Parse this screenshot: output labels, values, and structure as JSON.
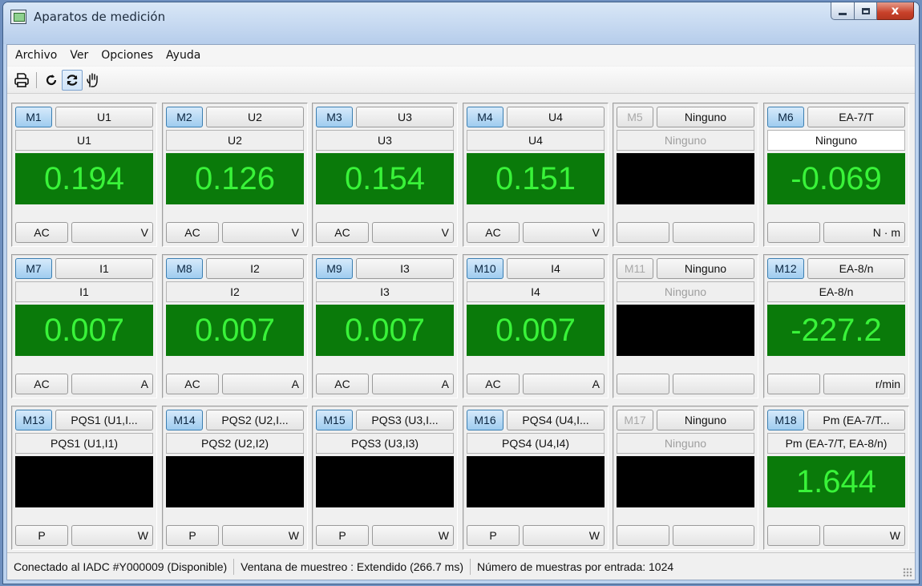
{
  "window": {
    "title": "Aparatos de medición",
    "close_glyph": "x"
  },
  "menu": [
    "Archivo",
    "Ver",
    "Opciones",
    "Ayuda"
  ],
  "toolbar": {
    "icons": [
      "printer-icon",
      "refresh-once-icon",
      "refresh-continuous-icon",
      "hand-icon"
    ],
    "active": "refresh-continuous-icon"
  },
  "colors": {
    "display_live": "#0a7a0a",
    "display_text": "#39f339",
    "display_off": "#000000",
    "button_active": "#9fccef"
  },
  "meters": [
    {
      "id": "M1",
      "active": true,
      "channel": "U1",
      "label": "U1",
      "value": "0.194",
      "mode": "AC",
      "unit": "V"
    },
    {
      "id": "M2",
      "active": true,
      "channel": "U2",
      "label": "U2",
      "value": "0.126",
      "mode": "AC",
      "unit": "V"
    },
    {
      "id": "M3",
      "active": true,
      "channel": "U3",
      "label": "U3",
      "value": "0.154",
      "mode": "AC",
      "unit": "V"
    },
    {
      "id": "M4",
      "active": true,
      "channel": "U4",
      "label": "U4",
      "value": "0.151",
      "mode": "AC",
      "unit": "V"
    },
    {
      "id": "M5",
      "active": false,
      "channel": "Ninguno",
      "label": "Ninguno",
      "value": "",
      "mode": "",
      "unit": ""
    },
    {
      "id": "M6",
      "active": true,
      "channel": "EA-7/T",
      "label": "Ninguno",
      "value": "-0.069",
      "mode": "",
      "unit": "N · m"
    },
    {
      "id": "M7",
      "active": true,
      "channel": "I1",
      "label": "I1",
      "value": "0.007",
      "mode": "AC",
      "unit": "A"
    },
    {
      "id": "M8",
      "active": true,
      "channel": "I2",
      "label": "I2",
      "value": "0.007",
      "mode": "AC",
      "unit": "A"
    },
    {
      "id": "M9",
      "active": true,
      "channel": "I3",
      "label": "I3",
      "value": "0.007",
      "mode": "AC",
      "unit": "A"
    },
    {
      "id": "M10",
      "active": true,
      "channel": "I4",
      "label": "I4",
      "value": "0.007",
      "mode": "AC",
      "unit": "A"
    },
    {
      "id": "M11",
      "active": false,
      "channel": "Ninguno",
      "label": "Ninguno",
      "value": "",
      "mode": "",
      "unit": ""
    },
    {
      "id": "M12",
      "active": true,
      "channel": "EA-8/n",
      "label": "EA-8/n",
      "value": "-227.2",
      "mode": "",
      "unit": "r/min"
    },
    {
      "id": "M13",
      "active": true,
      "channel": "PQS1 (U1,I...",
      "label": "PQS1 (U1,I1)",
      "value": "",
      "mode": "P",
      "unit": "W"
    },
    {
      "id": "M14",
      "active": true,
      "channel": "PQS2 (U2,I...",
      "label": "PQS2 (U2,I2)",
      "value": "",
      "mode": "P",
      "unit": "W"
    },
    {
      "id": "M15",
      "active": true,
      "channel": "PQS3 (U3,I...",
      "label": "PQS3 (U3,I3)",
      "value": "",
      "mode": "P",
      "unit": "W"
    },
    {
      "id": "M16",
      "active": true,
      "channel": "PQS4 (U4,I...",
      "label": "PQS4 (U4,I4)",
      "value": "",
      "mode": "P",
      "unit": "W"
    },
    {
      "id": "M17",
      "active": false,
      "channel": "Ninguno",
      "label": "Ninguno",
      "value": "",
      "mode": "",
      "unit": ""
    },
    {
      "id": "M18",
      "active": true,
      "channel": "Pm (EA-7/T...",
      "label": "Pm (EA-7/T, EA-8/n)",
      "value": "1.644",
      "mode": "",
      "unit": "W"
    }
  ],
  "status": {
    "connection": "Conectado al IADC #Y000009  (Disponible)",
    "window": "Ventana de muestreo : Extendido (266.7 ms)",
    "samples": "Número de muestras por entrada: 1024"
  }
}
